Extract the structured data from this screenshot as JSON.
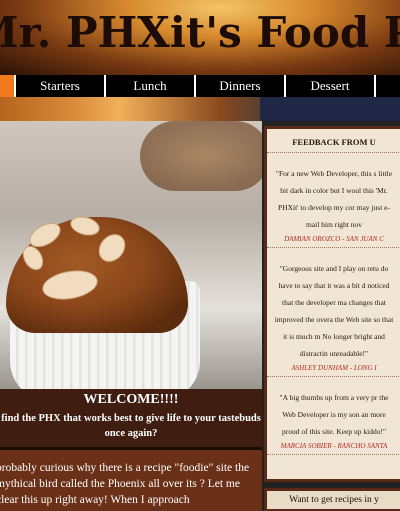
{
  "header": {
    "title": "Mr. PHXit's Food PHXe"
  },
  "nav": {
    "items": [
      {
        "label": "Starters"
      },
      {
        "label": "Lunch"
      },
      {
        "label": "Dinners"
      },
      {
        "label": "Dessert"
      }
    ]
  },
  "welcome": {
    "heading": "WELCOME!!!!",
    "subheading": "find the PHX that works best to give life to your tastebuds once again?",
    "intro": "probably curious why there is a recipe \"foodie\" site the mythical bird called the Phoenix all over its ? Let me clear this up right away! When I approach"
  },
  "feedback": {
    "heading": "FEEDBACK FROM U",
    "entries": [
      {
        "quote": "\"For a new Web Developer, this s little bit dark in color but I woul this 'Mr. PHXit' to develop my cor may just e-mail him right nov",
        "author": "DAMIAN OROZCO - SAN JUAN C"
      },
      {
        "quote": "\"Gorgeous site and I play on retu do have to say that it was a bit d noticed that the developer ma changes that improved the overa the Web site so that it is much m No longer bright and distractin unreadable!\"",
        "author": "ASHLEY DUNHAM - LONG I"
      },
      {
        "quote": "\"A big thumbs up from a very pr the Web Developer is my son an more proud of this site. Keep up kiddo!\"",
        "author": "MARCIA SOBIER - RANCHO SANTA"
      }
    ]
  },
  "recipes": {
    "label": "Want to get recipes in y"
  },
  "colors": {
    "nav_active": "#f07a1c",
    "panel_dark": "#3f1e11",
    "author_red": "#b02a1e"
  }
}
